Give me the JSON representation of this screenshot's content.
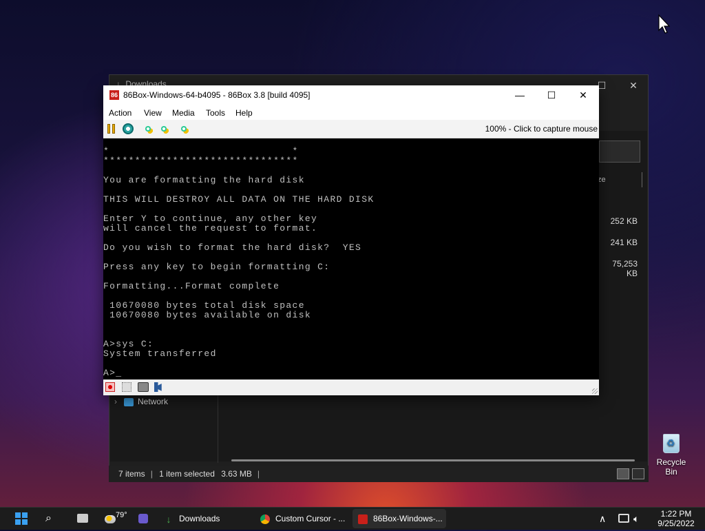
{
  "explorer": {
    "title": "Downloads",
    "size_header": "ze",
    "sizes": [
      "252 KB",
      "241 KB",
      "75,253 KB"
    ],
    "nav_network": "Network",
    "status": {
      "items": "7 items",
      "selected": "1 item selected",
      "size": "3.63 MB"
    },
    "buttons": {
      "minimize": "–",
      "maximize": "☐",
      "close": "✕"
    }
  },
  "emulator": {
    "title": "86Box-Windows-64-b4095 - 86Box 3.8 [build 4095]",
    "logo": "86",
    "caption": {
      "minimize": "—",
      "maximize": "☐",
      "close": "✕"
    },
    "menu": [
      "Action",
      "View",
      "Media",
      "Tools",
      "Help"
    ],
    "toolbar_status": "100% - Click to capture mouse",
    "screen_lines": [
      "*                             *",
      "*******************************",
      "",
      "You are formatting the hard disk",
      "",
      "THIS WILL DESTROY ALL DATA ON THE HARD DISK",
      "",
      "Enter Y to continue, any other key",
      "will cancel the request to format.",
      "",
      "Do you wish to format the hard disk?  YES",
      "",
      "Press any key to begin formatting C:",
      "",
      "Formatting...Format complete",
      "",
      " 10670080 bytes total disk space",
      " 10670080 bytes available on disk",
      "",
      "",
      "A>sys C:",
      "System transferred",
      "",
      "A>_"
    ]
  },
  "desktop": {
    "recycle_bin": "Recycle Bin"
  },
  "taskbar": {
    "weather": "79°",
    "apps": [
      {
        "label": "Downloads"
      },
      {
        "label": "Custom Cursor - ..."
      },
      {
        "label": "86Box-Windows-..."
      }
    ],
    "clock": {
      "time": "1:22 PM",
      "date": "9/25/2022"
    }
  }
}
